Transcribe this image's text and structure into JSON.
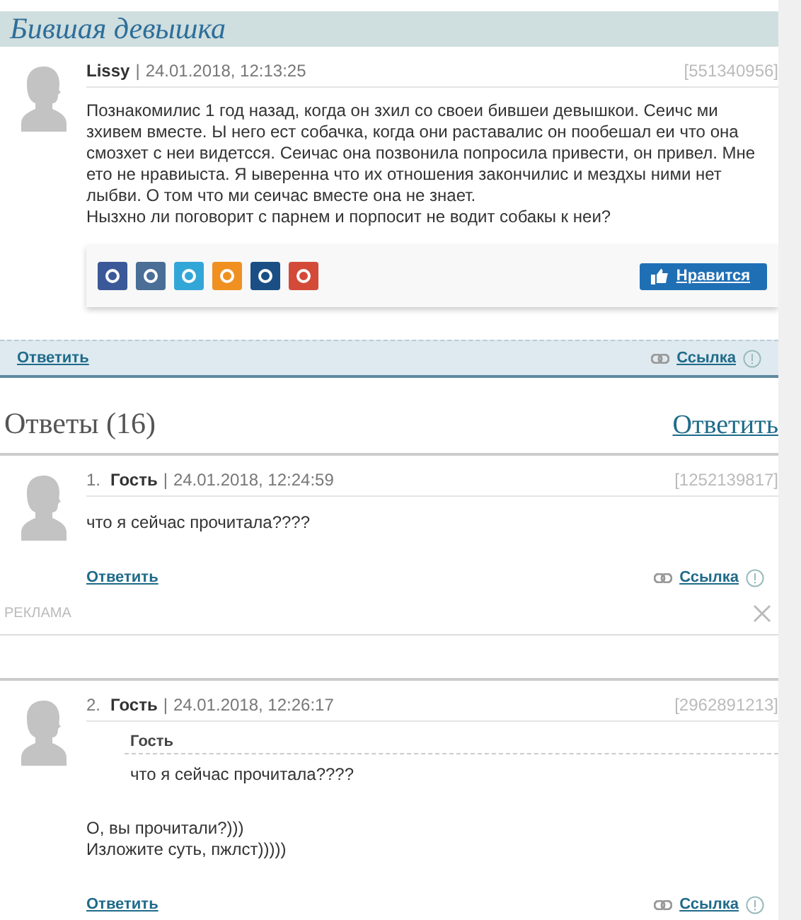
{
  "topic": {
    "title": "Бившая девышка"
  },
  "post": {
    "author": "Lissy",
    "separator": "|",
    "date": "24.01.2018, 12:13:25",
    "id": "[551340956]",
    "paragraphs": [
      "Познакомилис 1 год назад, когда он зхил со своеи бившеи девышкои. Сеичс ми зхивем вместе. Ы него ест собачка, когда они раставалис он пообешал еи что она смозхет с неи видетсся. Сеичас она позвонила попросила привести, он привел. Мне ето не нравиыста. Я ыверенна что их отношения закончилис и мездхы ними нет лыбви. О том что ми сеичас вместе она не знает.",
      "Нызхно ли поговорит с парнем и порпосит не водит собакы к неи?"
    ],
    "share": [
      {
        "color": "#3b5998"
      },
      {
        "color": "#4a6e96"
      },
      {
        "color": "#33a6d8"
      },
      {
        "color": "#f09020"
      },
      {
        "color": "#1a4e85"
      },
      {
        "color": "#d44a38"
      }
    ],
    "like": "Нравится",
    "reply": "Ответить",
    "link": "Ссылка"
  },
  "answers": {
    "heading": "Ответы (16)",
    "reply": "Ответить"
  },
  "comments": [
    {
      "kind": "plain",
      "number": "1.",
      "author": "Гость",
      "separator": "|",
      "date": "24.01.2018, 12:24:59",
      "id": "[1252139817]",
      "lines": [
        "что я сейчас прочитала????"
      ],
      "reply": "Ответить",
      "link": "Ссылка"
    },
    {
      "kind": "ad",
      "label": "РЕКЛАМА"
    },
    {
      "kind": "quoted",
      "number": "2.",
      "author": "Гость",
      "separator": "|",
      "date": "24.01.2018, 12:26:17",
      "id": "[2962891213]",
      "quote_author": "Гость",
      "quote": "что я сейчас прочитала????",
      "lines": [
        "О, вы прочитали?)))",
        "Изложите суть, пжлст)))))"
      ],
      "reply": "Ответить",
      "link": "Ссылка"
    }
  ]
}
